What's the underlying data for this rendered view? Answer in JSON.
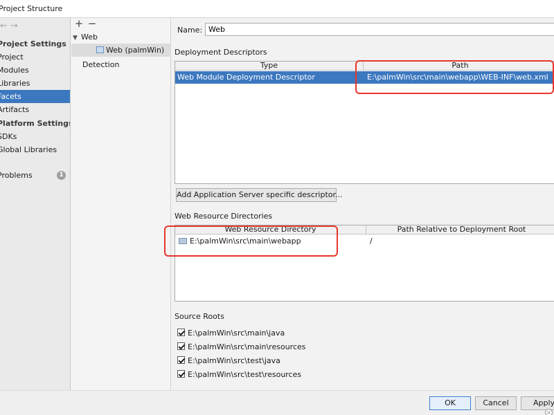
{
  "window": {
    "title": "Project Structure"
  },
  "nav": {
    "arrows": "← →",
    "items": [
      {
        "label": "Project Settings",
        "type": "header"
      },
      {
        "label": "Project",
        "type": "item"
      },
      {
        "label": "Modules",
        "type": "item"
      },
      {
        "label": "Libraries",
        "type": "item"
      },
      {
        "label": "Facets",
        "type": "item",
        "selected": true
      },
      {
        "label": "Artifacts",
        "type": "item"
      },
      {
        "label": "Platform Settings",
        "type": "header"
      },
      {
        "label": "SDKs",
        "type": "item"
      },
      {
        "label": "Global Libraries",
        "type": "item"
      },
      {
        "label": "Problems",
        "type": "item",
        "badge": "1"
      }
    ]
  },
  "tree": {
    "add_label": "+",
    "remove_label": "−",
    "group_label": "Web",
    "facet_label": "Web (palmWin)",
    "detection_label": "Detection"
  },
  "form": {
    "name_label": "Name:",
    "name_value": "Web"
  },
  "deployment_descriptors": {
    "section_label": "Deployment Descriptors",
    "columns": [
      "Type",
      "Path"
    ],
    "rows": [
      {
        "type": "Web Module Deployment Descriptor",
        "path": "E:\\palmWin\\src\\main\\webapp\\WEB-INF\\web.xml"
      }
    ],
    "add_button_label": "Add Application Server specific descriptor..."
  },
  "web_resource_directories": {
    "section_label": "Web Resource Directories",
    "columns": [
      "Web Resource Directory",
      "Path Relative to Deployment Root"
    ],
    "rows": [
      {
        "directory": "E:\\palmWin\\src\\main\\webapp",
        "relative_path": "/"
      }
    ]
  },
  "source_roots": {
    "section_label": "Source Roots",
    "items": [
      {
        "path": "E:\\palmWin\\src\\main\\java",
        "checked": true
      },
      {
        "path": "E:\\palmWin\\src\\main\\resources",
        "checked": true
      },
      {
        "path": "E:\\palmWin\\src\\test\\java",
        "checked": true
      },
      {
        "path": "E:\\palmWin\\src\\test\\resources",
        "checked": true
      }
    ]
  },
  "footer": {
    "ok_label": "OK",
    "cancel_label": "Cancel",
    "apply_label": "Apply"
  },
  "colors": {
    "selection": "#3c78c0",
    "annotation_highlight": "#e8352b"
  }
}
